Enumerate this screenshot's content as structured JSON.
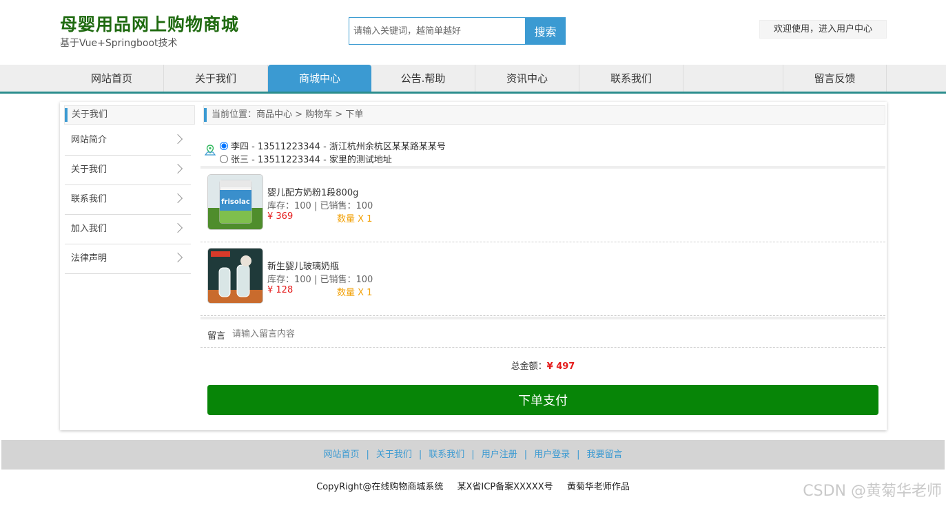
{
  "header": {
    "title": "母婴用品网上购物商城",
    "subtitle": "基于Vue+Springboot技术",
    "search_placeholder": "请输入关键词，越简单越好",
    "search_button": "搜索",
    "user_center": "欢迎使用，进入用户中心"
  },
  "nav": {
    "items": [
      {
        "label": "网站首页"
      },
      {
        "label": "关于我们"
      },
      {
        "label": "商城中心",
        "active": true
      },
      {
        "label": "公告.帮助"
      },
      {
        "label": "资讯中心"
      },
      {
        "label": "联系我们"
      },
      {
        "label": "留言反馈"
      }
    ]
  },
  "sidebar": {
    "title": "关于我们",
    "items": [
      {
        "label": "网站简介"
      },
      {
        "label": "关于我们"
      },
      {
        "label": "联系我们"
      },
      {
        "label": "加入我们"
      },
      {
        "label": "法律声明"
      }
    ]
  },
  "breadcrumb": {
    "prefix": "当前位置：",
    "path": "商品中心 > 购物车 > 下单"
  },
  "addresses": [
    {
      "text": "李四 - 13511223344 - 浙江杭州余杭区某某路某某号",
      "selected": true
    },
    {
      "text": "张三 - 13511223344 - 家里的测试地址",
      "selected": false
    }
  ],
  "products": [
    {
      "name": "婴儿配方奶粉1段800g",
      "stock": "库存：100 | 已销售：100",
      "price": "¥ 369",
      "qty": "数量 X 1",
      "image": "formula-milk-can"
    },
    {
      "name": "新生婴儿玻璃奶瓶",
      "stock": "库存：100 | 已销售：100",
      "price": "¥ 128",
      "qty": "数量 X 1",
      "image": "glass-baby-bottles"
    }
  ],
  "message": {
    "label": "留言",
    "placeholder": "请输入留言内容"
  },
  "total": {
    "label": "总金额：",
    "value": "¥ 497"
  },
  "pay_button": "下单支付",
  "footer": {
    "links": [
      "网站首页",
      "关于我们",
      "联系我们",
      "用户注册",
      "用户登录",
      "我要留言"
    ],
    "copyright": "CopyRight@在线购物商城系统",
    "icp": "某X省ICP备案XXXXX号",
    "author": "黄菊华老师作品"
  },
  "watermark": "CSDN @黄菊华老师",
  "colors": {
    "brand_green": "#1f6a10",
    "accent_blue": "#3b9ad2",
    "pay_green": "#078507",
    "price_red": "#e41b1b",
    "qty_orange": "#f2a20a"
  }
}
